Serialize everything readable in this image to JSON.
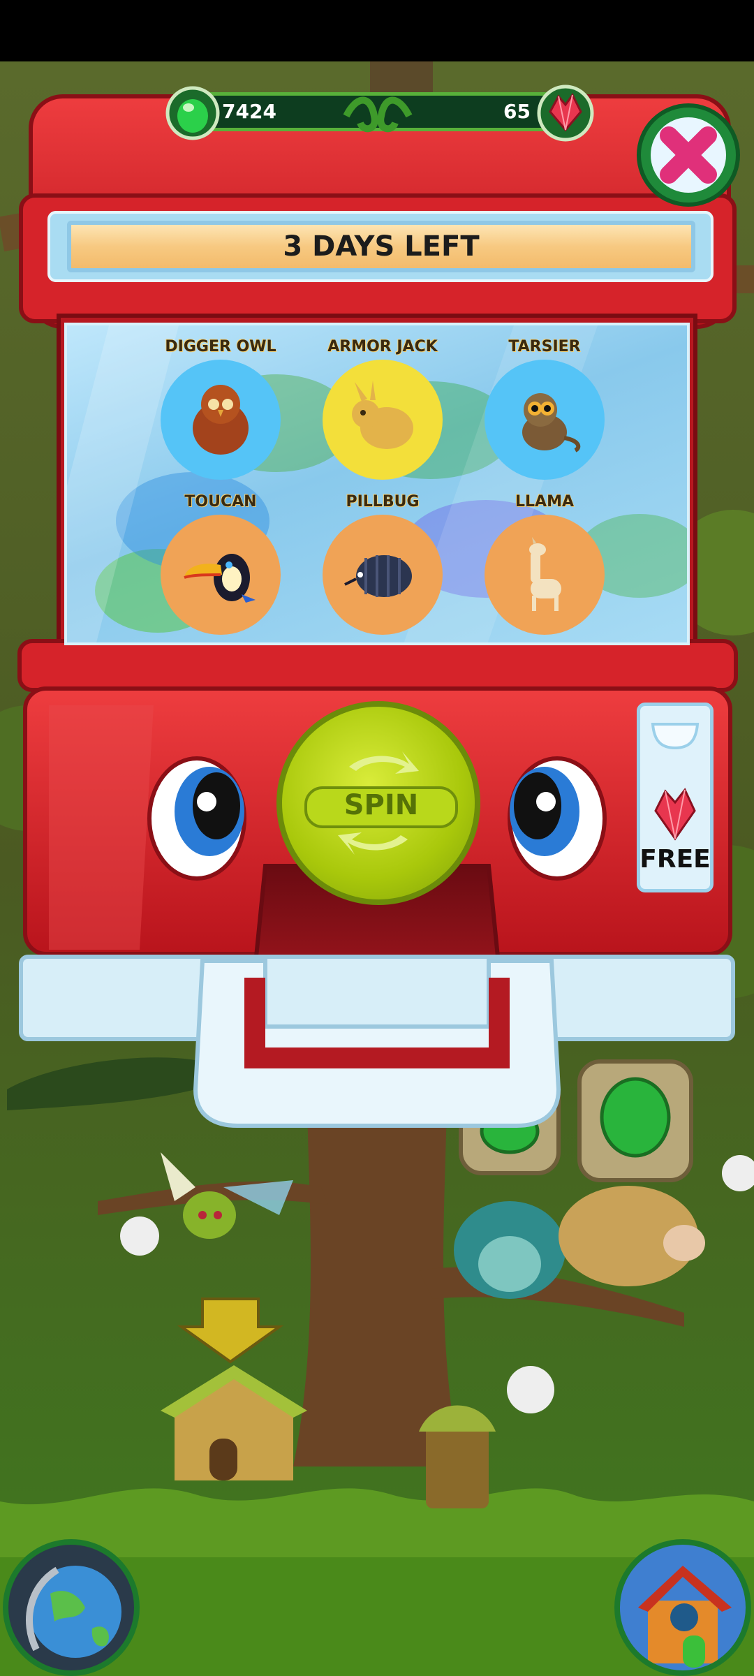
{
  "currency": {
    "green_gems": "7424",
    "red_gems": "65"
  },
  "machine": {
    "days_left": "3 DAYS LEFT",
    "spin_label": "SPIN",
    "free_label": "FREE"
  },
  "pets": [
    {
      "name": "DIGGER OWL",
      "circle_color": "#55c4f7"
    },
    {
      "name": "ARMOR JACK",
      "circle_color": "#f3df3a"
    },
    {
      "name": "TARSIER",
      "circle_color": "#55c4f7"
    },
    {
      "name": "TOUCAN",
      "circle_color": "#f0a356"
    },
    {
      "name": "PILLBUG",
      "circle_color": "#f0a356"
    },
    {
      "name": "LLAMA",
      "circle_color": "#f0a356"
    }
  ],
  "icons": {
    "close": "close-x-icon",
    "world": "globe-icon",
    "home": "house-icon",
    "spin_arrows": "refresh-arrows-icon",
    "free_gem": "red-crystal-icon"
  },
  "colors": {
    "machine_red": "#d8232a",
    "machine_dark_red": "#9e1018",
    "accent_green": "#58b13a",
    "spin_green": "#a9c80b",
    "glass_blue": "#89c9ec"
  }
}
